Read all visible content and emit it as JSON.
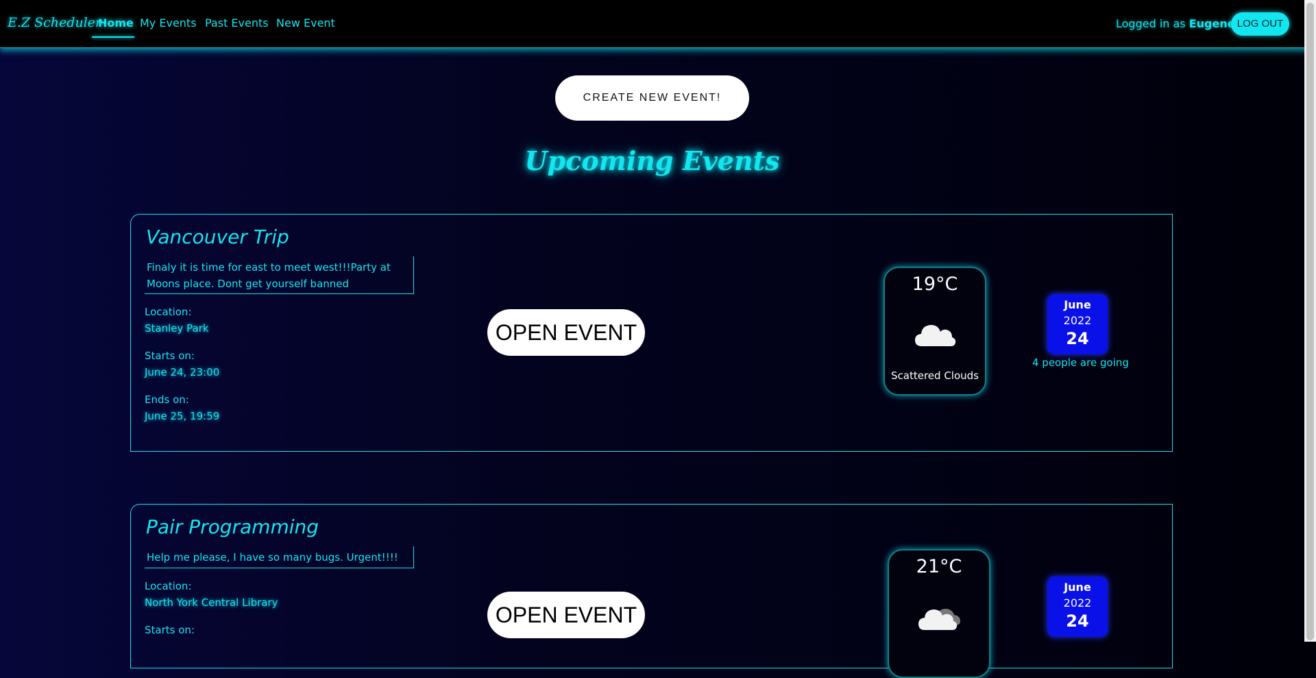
{
  "nav": {
    "brand": "E.Z Scheduler",
    "links": [
      "Home",
      "My Events",
      "Past Events",
      "New Event"
    ],
    "logged_prefix": "Logged in as",
    "username": "Eugene",
    "logout_label": "LOG OUT"
  },
  "create_button": "CREATE NEW EVENT!",
  "section_title": "Upcoming Events",
  "events": [
    {
      "title": "Vancouver Trip",
      "description": "Finaly it is time for east to meet west!!!Party at Moons place. Dont get yourself banned",
      "location_label": "Location:",
      "location": "Stanley Park",
      "starts_label": "Starts on:",
      "starts": "June 24, 23:00",
      "ends_label": "Ends on:",
      "ends": "June 25, 19:59",
      "open_label": "OPEN EVENT",
      "weather": {
        "temp": "19°C",
        "icon": "scattered-clouds-icon",
        "desc": "Scattered Clouds"
      },
      "date": {
        "month": "June",
        "year": "2022",
        "day": "24"
      },
      "going": "4 people are going"
    },
    {
      "title": "Pair Programming",
      "description": "Help me please, I have so many bugs. Urgent!!!!",
      "location_label": "Location:",
      "location": "North York Central Library",
      "starts_label": "Starts on:",
      "open_label": "OPEN EVENT",
      "weather": {
        "temp": "21°C",
        "icon": "broken-clouds-icon"
      },
      "date": {
        "month": "June",
        "year": "2022",
        "day": "24"
      }
    }
  ],
  "colors": {
    "accent": "#12e6f0",
    "date_badge": "#0a10e8",
    "navbar": "#000000"
  }
}
